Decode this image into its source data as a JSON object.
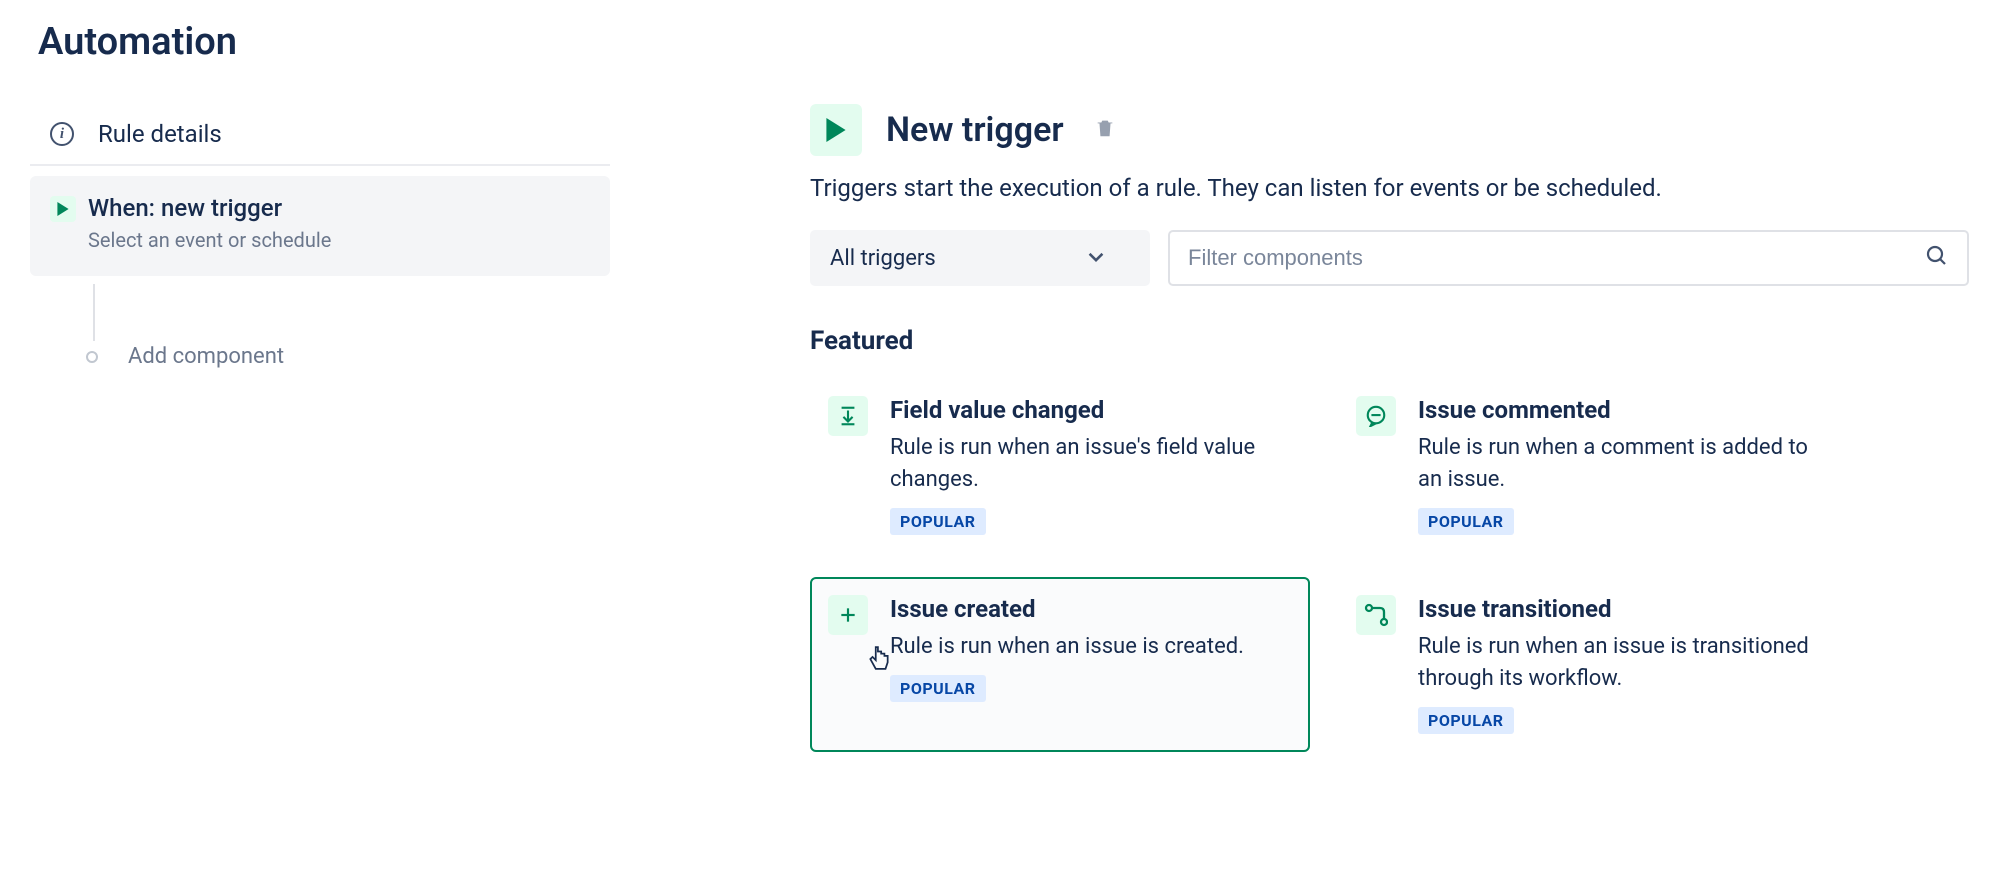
{
  "page": {
    "title": "Automation"
  },
  "sidebar": {
    "rule_details": "Rule details",
    "trigger": {
      "title": "When: new trigger",
      "subtitle": "Select an event or schedule"
    },
    "add_component": "Add component"
  },
  "main": {
    "title": "New trigger",
    "description": "Triggers start the execution of a rule. They can listen for events or be scheduled.",
    "filter_select": "All triggers",
    "search_placeholder": "Filter components",
    "section": "Featured",
    "badge": "POPULAR",
    "cards": [
      {
        "title": "Field value changed",
        "desc": "Rule is run when an issue's field value changes."
      },
      {
        "title": "Issue commented",
        "desc": "Rule is run when a comment is added to an issue."
      },
      {
        "title": "Issue created",
        "desc": "Rule is run when an issue is created."
      },
      {
        "title": "Issue transitioned",
        "desc": "Rule is run when an issue is transitioned through its workflow."
      }
    ]
  }
}
